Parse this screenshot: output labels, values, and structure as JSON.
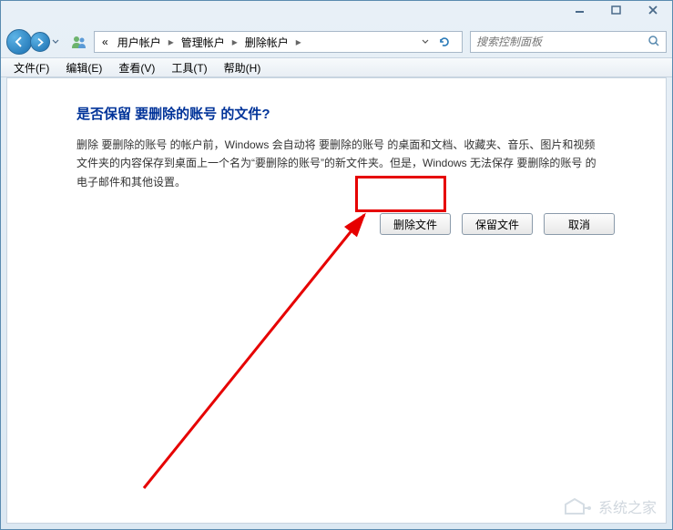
{
  "titlebar": {
    "minimize": "minimize",
    "maximize": "maximize",
    "close": "close"
  },
  "breadcrumb": {
    "prefix": "«",
    "items": [
      "用户帐户",
      "管理帐户",
      "删除帐户"
    ]
  },
  "search": {
    "placeholder": "搜索控制面板"
  },
  "menu": {
    "file": "文件(F)",
    "edit": "编辑(E)",
    "view": "查看(V)",
    "tools": "工具(T)",
    "help": "帮助(H)"
  },
  "content": {
    "heading": "是否保留 要删除的账号 的文件?",
    "body": "删除 要删除的账号 的帐户前，Windows 会自动将 要删除的账号 的桌面和文档、收藏夹、音乐、图片和视频文件夹的内容保存到桌面上一个名为“要删除的账号”的新文件夹。但是，Windows 无法保存 要删除的账号 的电子邮件和其他设置。"
  },
  "buttons": {
    "delete": "删除文件",
    "keep": "保留文件",
    "cancel": "取消"
  },
  "watermark": {
    "text": "系统之家"
  }
}
